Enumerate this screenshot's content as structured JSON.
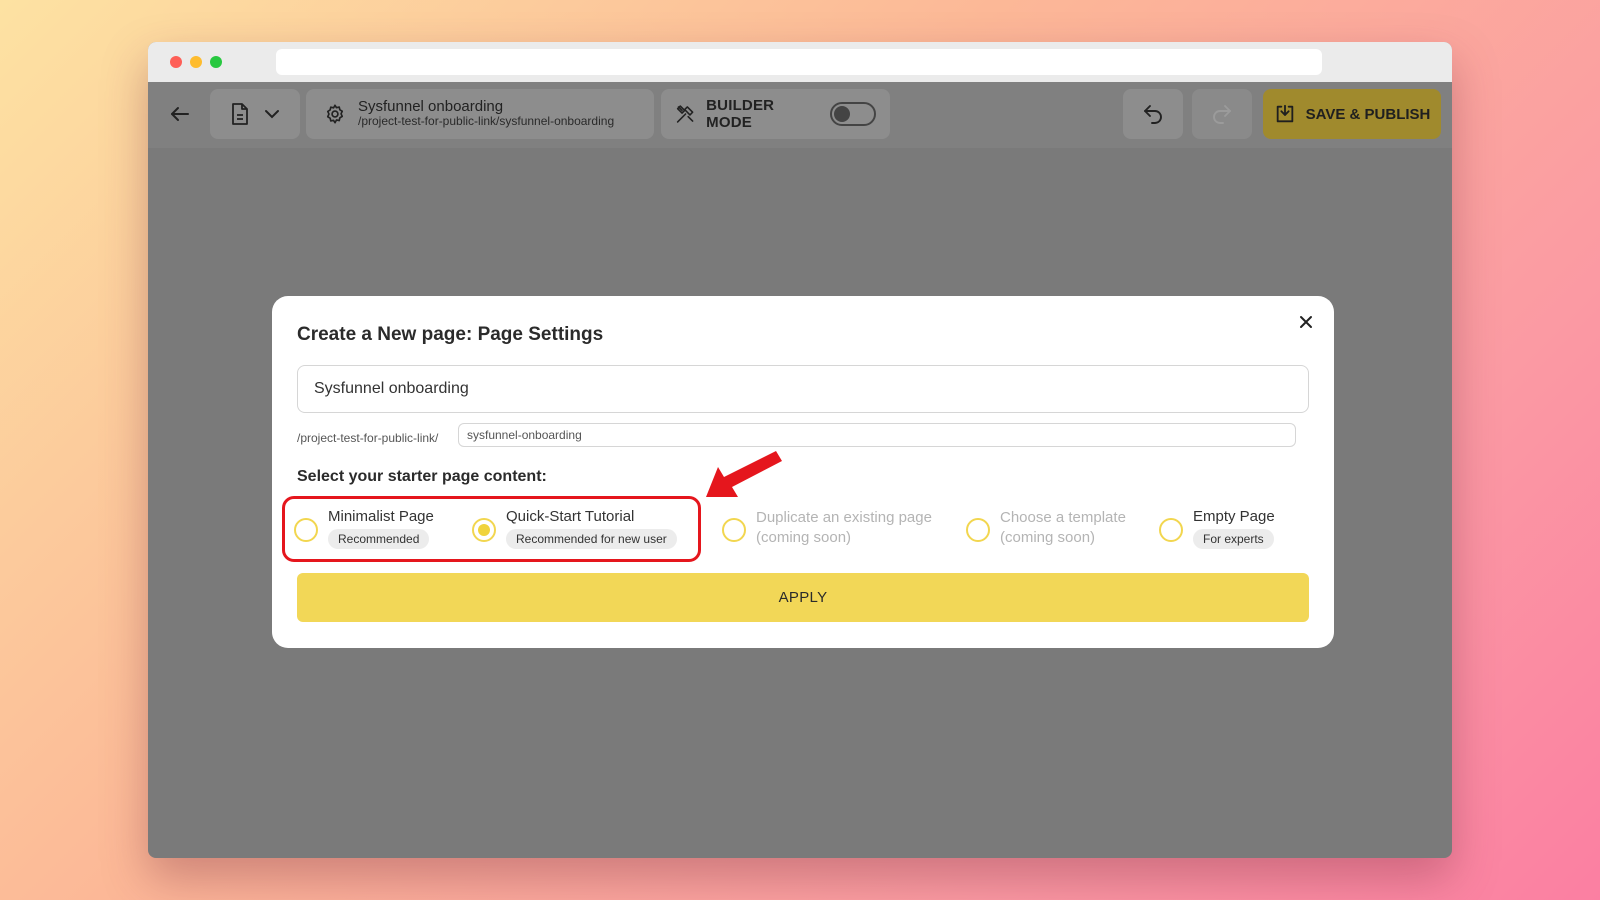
{
  "toolbar": {
    "project_title": "Sysfunnel onboarding",
    "project_path": "/project-test-for-public-link/sysfunnel-onboarding",
    "builder_mode_label": "BUILDER MODE",
    "builder_mode_on": false,
    "save_label": "SAVE & PUBLISH",
    "accent_color": "#a08a2d"
  },
  "modal": {
    "title": "Create a New page: Page Settings",
    "page_name_value": "Sysfunnel onboarding",
    "slug_prefix": "/project-test-for-public-link/",
    "slug_value": "sysfunnel-onboarding",
    "section_label": "Select your starter page content:",
    "options": [
      {
        "label": "Minimalist Page",
        "badge": "Recommended",
        "selected": false,
        "disabled": false
      },
      {
        "label": "Quick-Start Tutorial",
        "badge": "Recommended for new user",
        "selected": true,
        "disabled": false
      },
      {
        "label": "Duplicate an existing page",
        "sub": "(coming soon)",
        "selected": false,
        "disabled": true
      },
      {
        "label": "Choose a template",
        "sub": "(coming soon)",
        "selected": false,
        "disabled": true
      },
      {
        "label": "Empty Page",
        "badge": "For experts",
        "selected": false,
        "disabled": false
      }
    ],
    "apply_label": "APPLY",
    "apply_color": "#f2d757"
  },
  "annotation": {
    "highlight_color": "#e5161d"
  }
}
